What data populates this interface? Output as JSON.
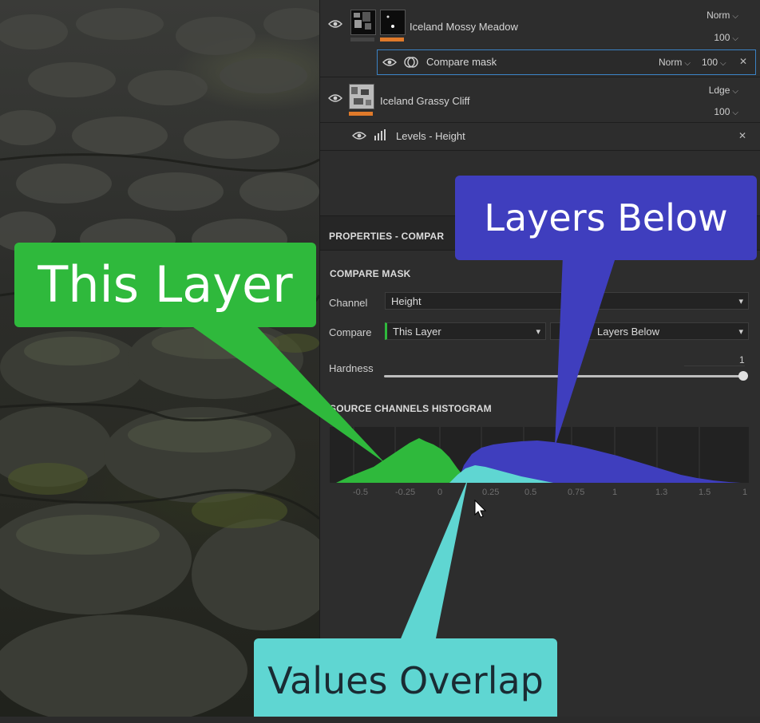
{
  "layers": [
    {
      "name": "Iceland Mossy Meadow",
      "blend": "Norm",
      "opacity": "100",
      "swatch": "#e07a2a"
    },
    {
      "name": "Iceland Grassy Cliff",
      "blend": "Ldge",
      "opacity": "100",
      "swatch": "#e07a2a"
    }
  ],
  "compare_mask": {
    "label": "Compare mask",
    "blend": "Norm",
    "opacity": "100"
  },
  "levels": {
    "label": "Levels - Height"
  },
  "properties": {
    "header": "PROPERTIES - COMPAR",
    "section": "COMPARE MASK",
    "channel_label": "Channel",
    "channel_value": "Height",
    "compare_label": "Compare",
    "compare_a": "This Layer",
    "compare_op": ">",
    "compare_b": "Layers Below",
    "hardness_label": "Hardness",
    "hardness_value": "1",
    "histogram_title": "SOURCE CHANNELS HISTOGRAM",
    "axis_ticks": [
      "-0.5",
      "-0.25",
      "0",
      "0.25",
      "0.5",
      "0.75",
      "1",
      "1.3",
      "1.5",
      "1"
    ]
  },
  "callouts": {
    "this_layer": "This Layer",
    "layers_below": "Layers Below",
    "values_overlap": "Values Overlap"
  },
  "colors": {
    "green": "#2fb93c",
    "blue": "#3f3ebe",
    "teal": "#5fd6d2",
    "orange": "#e07a2a"
  }
}
